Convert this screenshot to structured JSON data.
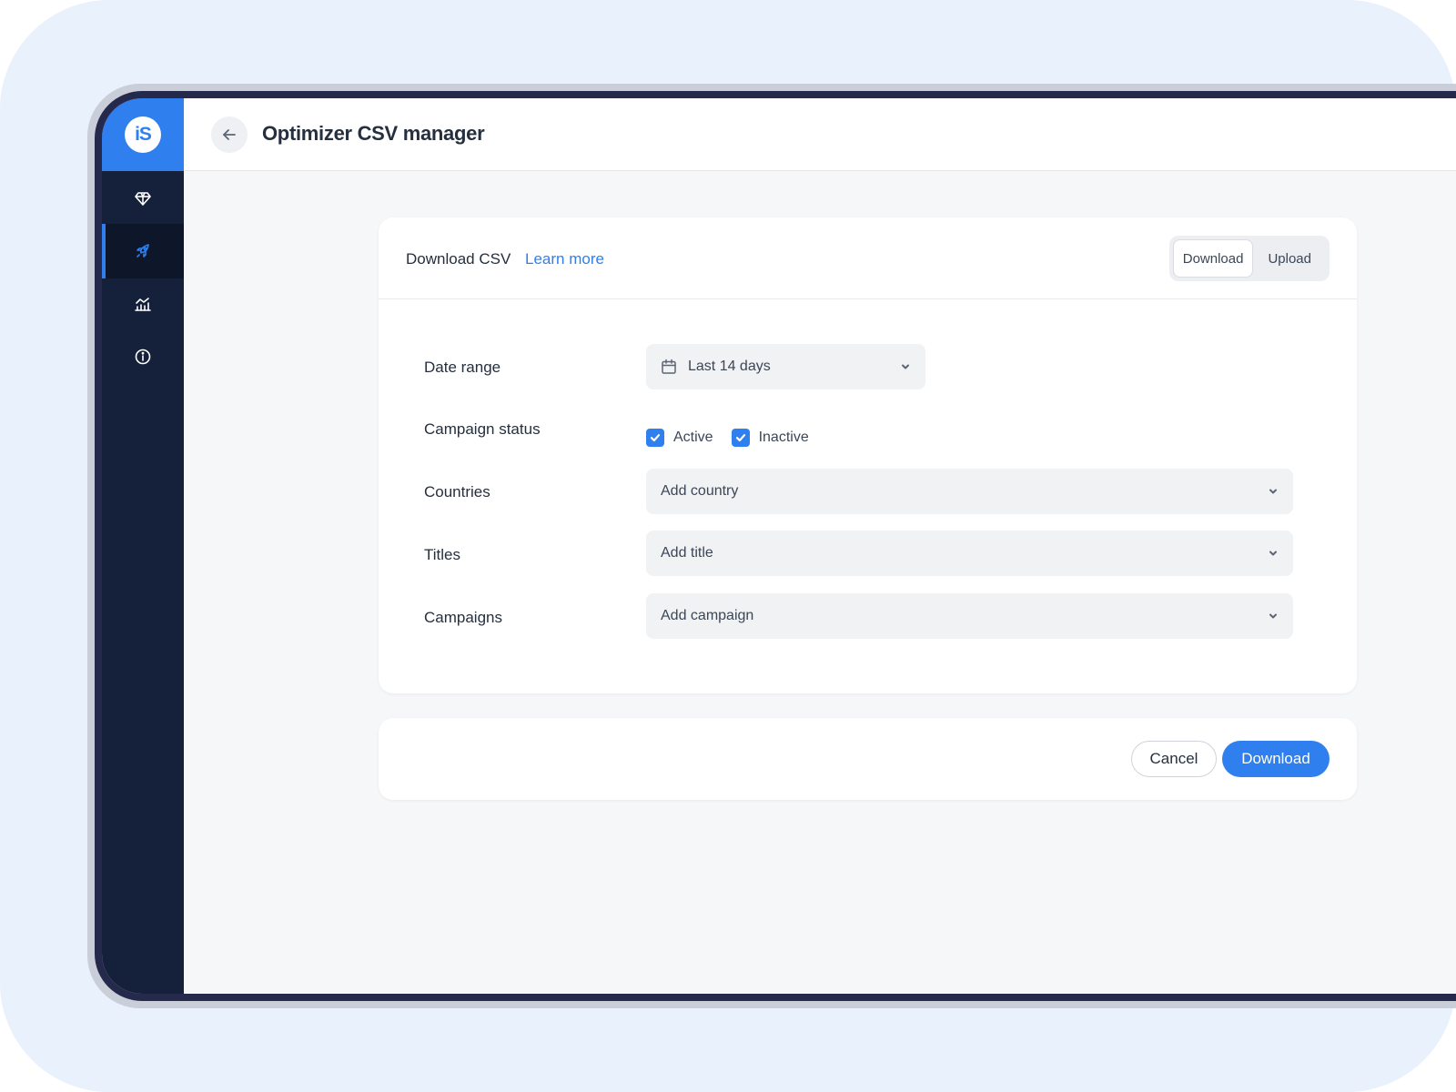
{
  "app": {
    "logo_text": "iS",
    "page_title": "Optimizer CSV manager"
  },
  "sidebar": {
    "items": [
      {
        "icon": "diamond-icon",
        "active": false
      },
      {
        "icon": "rocket-icon",
        "active": true
      },
      {
        "icon": "analytics-icon",
        "active": false
      },
      {
        "icon": "info-icon",
        "active": false
      }
    ]
  },
  "card": {
    "title": "Download CSV",
    "learn_more": "Learn more",
    "mode_toggle": {
      "options": [
        "Download",
        "Upload"
      ],
      "selected": "Download"
    }
  },
  "form": {
    "date_range": {
      "label": "Date range",
      "value": "Last 14 days"
    },
    "campaign_status": {
      "label": "Campaign status",
      "options": [
        {
          "label": "Active",
          "checked": true
        },
        {
          "label": "Inactive",
          "checked": true
        }
      ]
    },
    "countries": {
      "label": "Countries",
      "placeholder": "Add country"
    },
    "titles": {
      "label": "Titles",
      "placeholder": "Add title"
    },
    "campaigns": {
      "label": "Campaigns",
      "placeholder": "Add campaign"
    }
  },
  "footer": {
    "cancel_label": "Cancel",
    "download_label": "Download"
  },
  "colors": {
    "accent": "#2f80ee",
    "sidebar": "#15213a",
    "backdrop": "#e9f1fd"
  }
}
